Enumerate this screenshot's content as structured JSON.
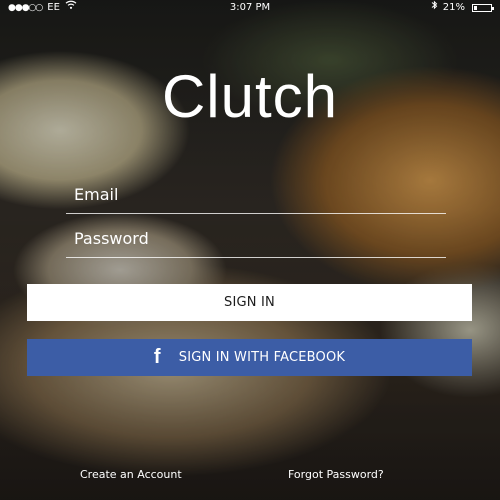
{
  "status_bar": {
    "signal": "●●●○○",
    "carrier": "EE",
    "wifi_icon": "wifi-icon",
    "time": "3:07 PM",
    "bluetooth_icon": "bluetooth-icon",
    "battery_percent": "21%",
    "battery_level": 0.21
  },
  "app": {
    "logo": "Clutch"
  },
  "form": {
    "email_placeholder": "Email",
    "password_placeholder": "Password"
  },
  "buttons": {
    "sign_in": "SIGN IN",
    "facebook": "SIGN IN WITH FACEBOOK",
    "facebook_icon": "facebook-icon"
  },
  "links": {
    "create_account": "Create an Account",
    "forgot_password": "Forgot Password?"
  },
  "colors": {
    "accent_facebook": "#3c5da6",
    "primary_button": "#ffffff",
    "text": "#ffffff"
  }
}
